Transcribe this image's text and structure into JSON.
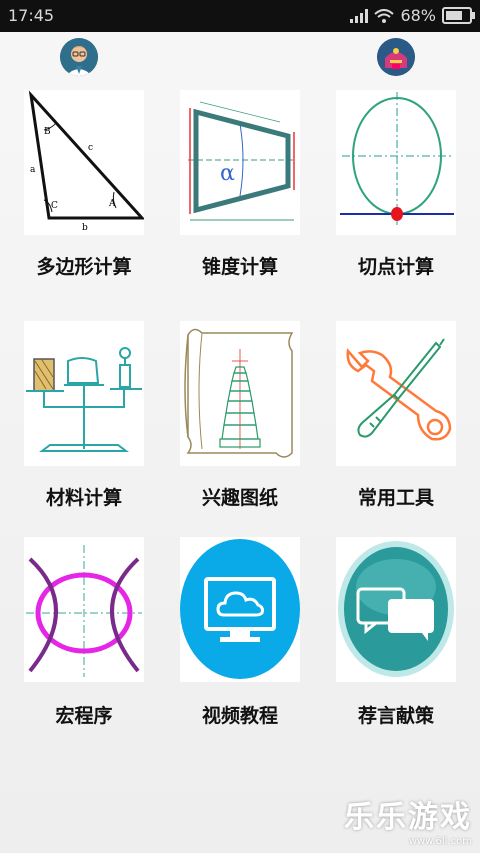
{
  "statusbar": {
    "time": "17:45",
    "battery": "68%"
  },
  "header": {
    "user_icon": "user-avatar-icon",
    "shop_icon": "shop-icon"
  },
  "tiles": [
    {
      "label": "多边形计算",
      "icon": "triangle-icon",
      "triangle": {
        "a": "a",
        "b": "b",
        "c": "c",
        "A": "A",
        "B": "B",
        "C": "C"
      }
    },
    {
      "label": "锥度计算",
      "icon": "taper-icon",
      "alpha": "α"
    },
    {
      "label": "切点计算",
      "icon": "tangent-point-icon"
    },
    {
      "label": "材料计算",
      "icon": "scale-icon"
    },
    {
      "label": "兴趣图纸",
      "icon": "pagoda-scroll-icon"
    },
    {
      "label": "常用工具",
      "icon": "tools-icon"
    },
    {
      "label": "宏程序",
      "icon": "macro-curve-icon"
    },
    {
      "label": "视频教程",
      "icon": "video-monitor-icon"
    },
    {
      "label": "荐言献策",
      "icon": "feedback-chat-icon"
    }
  ],
  "watermark": {
    "text": "乐乐游戏",
    "url": "www.6ll.com"
  }
}
